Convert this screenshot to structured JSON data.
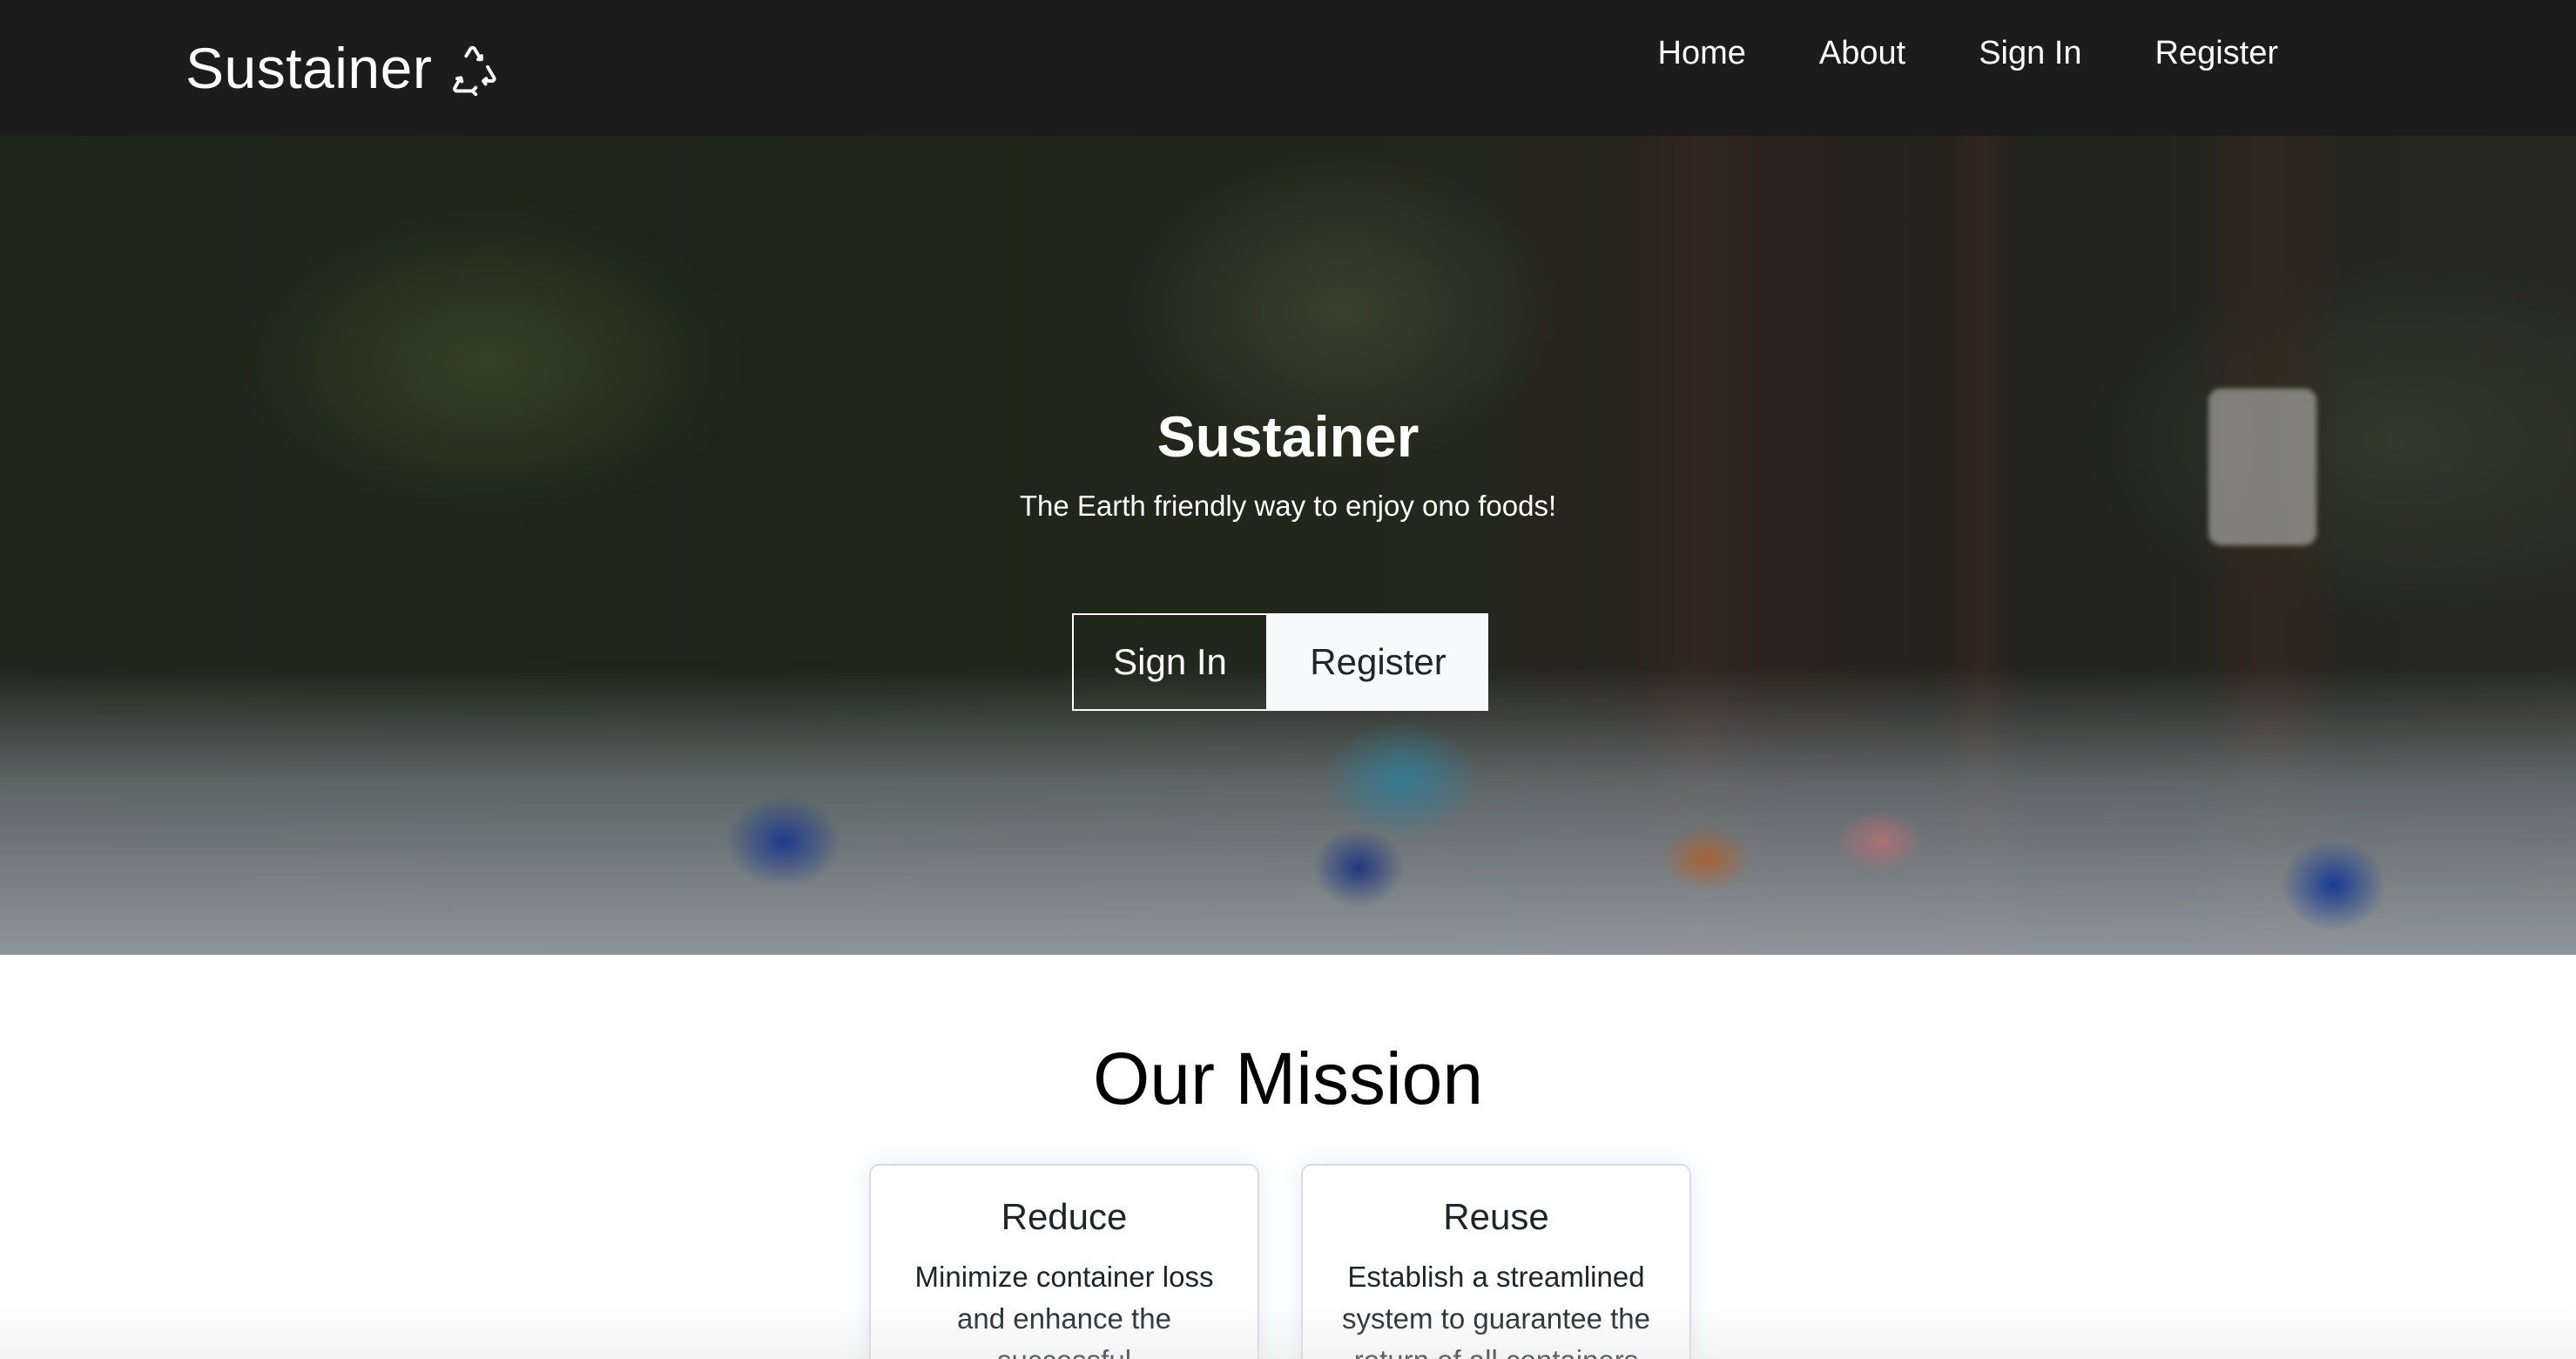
{
  "navbar": {
    "brand": "Sustainer",
    "brand_icon": "recycle-icon",
    "links": [
      "Home",
      "About",
      "Sign In",
      "Register"
    ]
  },
  "hero": {
    "title": "Sustainer",
    "subtitle": "The Earth friendly way to enjoy ono foods!",
    "sign_in_label": "Sign In",
    "register_label": "Register"
  },
  "mission": {
    "title": "Our Mission",
    "cards": [
      {
        "title": "Reduce",
        "text": "Minimize container loss and enhance the successful"
      },
      {
        "title": "Reuse",
        "text": "Establish a streamlined system to guarantee the return of all containers"
      }
    ]
  },
  "colors": {
    "navbar_bg": "#1c1c1d",
    "nav_text": "#ffffff",
    "button_light_bg": "#f8f9fa",
    "card_border": "#d8dbe0"
  }
}
